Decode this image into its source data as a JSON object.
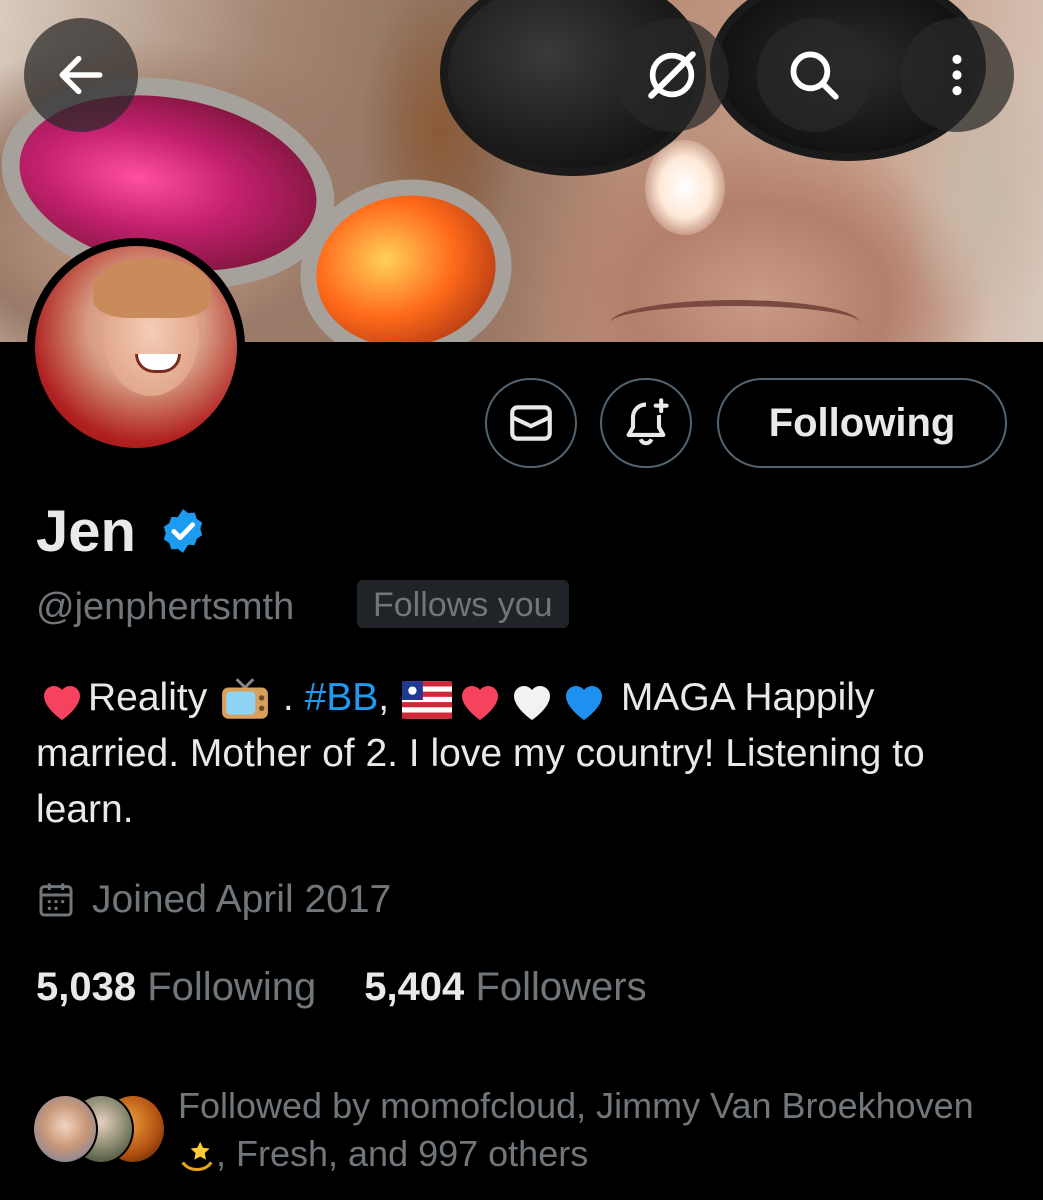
{
  "header": {
    "back_icon": "arrow-left-icon",
    "grok_icon": "grok-icon",
    "search_icon": "search-icon",
    "more_icon": "more-vertical-icon"
  },
  "actions": {
    "message_icon": "envelope-icon",
    "notify_icon": "bell-plus-icon",
    "following_label": "Following"
  },
  "profile": {
    "name": "Jen",
    "handle": "@jenphertsmth",
    "follows_you": "Follows you",
    "bio": {
      "reality": "Reality",
      "dot": " . ",
      "hashtag": "#BB",
      "comma": ",",
      "maga": " MAGA Happily",
      "rest": "married. Mother of 2. I love my country! Listening to learn."
    },
    "joined": "Joined April 2017",
    "following_count": "5,038",
    "following_label": "Following",
    "followers_count": "5,404",
    "followers_label": "Followers",
    "followed_by_prefix": "Followed by momofcloud, Jimmy Van Broekhoven",
    "followed_by_suffix": ", Fresh, and 997 others"
  },
  "colors": {
    "accent": "#1d9bf0",
    "muted": "#71767b",
    "text": "#e7e9ea",
    "border": "#536471"
  }
}
